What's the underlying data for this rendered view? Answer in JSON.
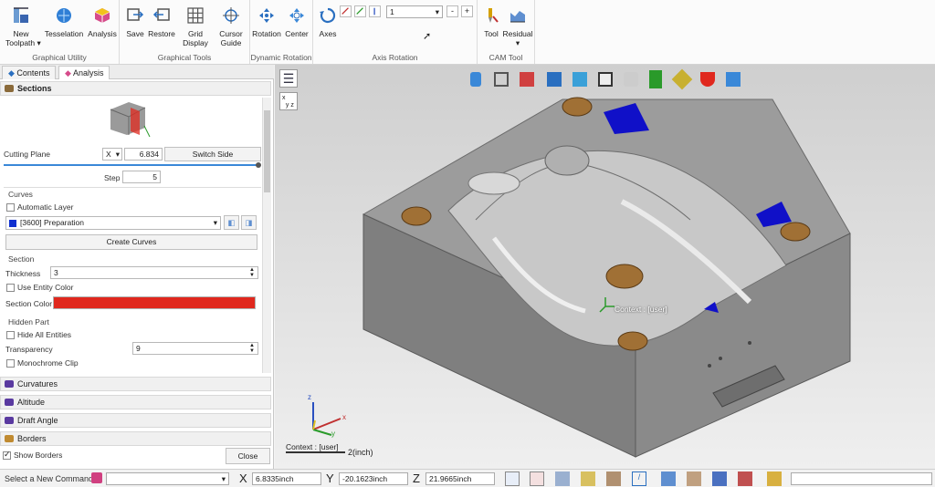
{
  "ribbon": {
    "groups": [
      {
        "caption": "Graphical Utility",
        "buttons": [
          "New\nToolpath ▾",
          "Tesselation",
          "Analysis"
        ]
      },
      {
        "caption": "Graphical Tools",
        "buttons": [
          "Save",
          "Restore",
          "Grid\nDisplay",
          "Cursor\nGuide"
        ]
      },
      {
        "caption": "Dynamic Rotation",
        "buttons": [
          "Rotation",
          "Center"
        ]
      },
      {
        "caption": "Axis Rotation",
        "buttons": [
          "Axes"
        ],
        "combo_value": "1",
        "minus": "-",
        "plus": "+"
      },
      {
        "caption": "CAM Tool",
        "buttons": [
          "Tool",
          "Residual\n▾"
        ]
      }
    ]
  },
  "panel": {
    "tabs": [
      "Contents",
      "Analysis"
    ],
    "sections_title": "Sections",
    "cutting_plane_label": "Cutting Plane",
    "axis_value": "X",
    "plane_value": "6.834",
    "switch_side": "Switch Side",
    "step_label": "Step",
    "step_value": "5",
    "curves_title": "Curves",
    "automatic_layer": "Automatic Layer",
    "layer_value": "[3600] Preparation",
    "create_curves": "Create Curves",
    "section_title": "Section",
    "thickness_label": "Thickness",
    "thickness_value": "3",
    "use_entity_color": "Use Entity Color",
    "section_color_label": "Section Color",
    "hidden_part_title": "Hidden Part",
    "hide_all_entities": "Hide All Entities",
    "transparency_label": "Transparency",
    "transparency_value": "9",
    "monochrome_clip": "Monochrome Clip",
    "collapsed_sections": [
      "Curvatures",
      "Altitude",
      "Draft Angle",
      "Borders"
    ],
    "show_borders": "Show Borders",
    "close": "Close"
  },
  "viewport": {
    "context_label": "Context : [user]",
    "context_label_bottom": "Context : [user]",
    "units_label": "2(inch)",
    "triad_x": "x",
    "triad_y": "y",
    "triad_z": "z"
  },
  "status": {
    "command_placeholder": "Select a New Command...",
    "x_label": "X",
    "x_value": "6.8335inch",
    "y_label": "Y",
    "y_value": "-20.1623inch",
    "z_label": "Z",
    "z_value": "21.9665inch"
  },
  "colors": {
    "section_color": "#e0281e",
    "layer_swatch": "#1030d0",
    "part_gray": "#8d8d8d",
    "pocket_brown": "#a07035",
    "accent_blue": "#1010c8"
  }
}
